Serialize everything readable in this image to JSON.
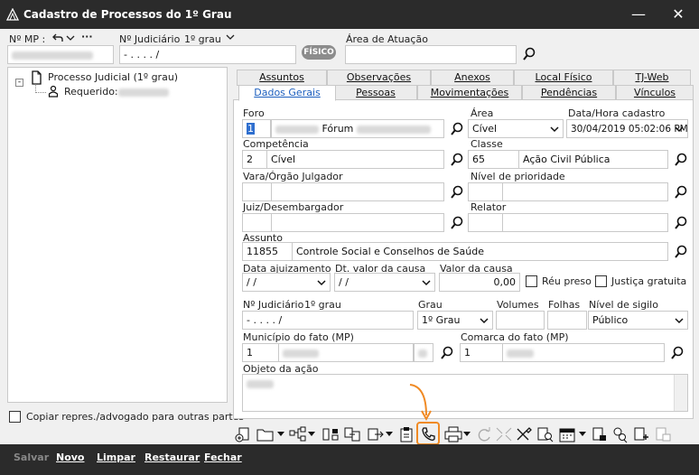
{
  "window": {
    "title": "Cadastro de Processos do 1º Grau"
  },
  "header": {
    "mp_label": "Nº MP :",
    "judicial_label": "Nº Judiciário",
    "grau_label": "1º grau",
    "judicial_value": "-   .   .  .   .   /",
    "fisico_badge": "FÍSICO",
    "area_atuacao_label": "Área de Atuação"
  },
  "tree": {
    "root": "Processo Judicial (1º grau)",
    "child_label": "Requerido:"
  },
  "copy_checkbox": {
    "label": "Copiar repres./advogado para outras partes"
  },
  "tabs": {
    "row1": [
      "Assuntos",
      "Observações",
      "Anexos",
      "Local Físico",
      "TJ-Web"
    ],
    "row2": [
      "Dados Gerais",
      "Pessoas",
      "Movimentações",
      "Pendências",
      "Vínculos"
    ]
  },
  "form": {
    "foro_label": "Foro",
    "foro_code": "1",
    "foro_text": "Fórum",
    "area_label": "Área",
    "area_value": "Cível",
    "data_cadastro_label": "Data/Hora cadastro",
    "data_cadastro_value": "30/04/2019 05:02:06 PM",
    "competencia_label": "Competência",
    "competencia_code": "2",
    "competencia_text": "Cível",
    "classe_label": "Classe",
    "classe_code": "65",
    "classe_text": "Ação Civil Pública",
    "vara_label": "Vara/Órgão Julgador",
    "prioridade_label": "Nível de prioridade",
    "juiz_label": "Juiz/Desembargador",
    "relator_label": "Relator",
    "assunto_label": "Assunto",
    "assunto_code": "11855",
    "assunto_text": "Controle Social e Conselhos de Saúde",
    "data_ajuizamento_label": "Data ajuizamento",
    "data_ajuizamento_value": " / /",
    "dt_valor_label": "Dt. valor da causa",
    "dt_valor_value": " / /",
    "valor_causa_label": "Valor da causa",
    "valor_causa_value": "0,00",
    "reu_preso_label": "Réu preso",
    "justica_gratuita_label": "Justiça gratuita",
    "judiciario_label": "Nº Judiciário",
    "judiciario_grau": "1º grau",
    "judiciario_value": "-   .   .  .   .   /",
    "grau_label": "Grau",
    "grau_value": "1º Grau",
    "volumes_label": "Volumes",
    "folhas_label": "Folhas",
    "sigilo_label": "Nível de sigilo",
    "sigilo_value": "Público",
    "municipio_label": "Município do fato (MP)",
    "municipio_code": "1",
    "comarca_label": "Comarca do fato (MP)",
    "comarca_code": "1",
    "objeto_label": "Objeto da ação"
  },
  "bottom": {
    "salvar": "Salvar",
    "novo": "Novo",
    "limpar": "Limpar",
    "restaurar": "Restaurar",
    "fechar": "Fechar"
  },
  "colors": {
    "titlebar": "#2b2b2b",
    "highlight": "#f08a24",
    "active_tab": "#1c5fbf"
  }
}
